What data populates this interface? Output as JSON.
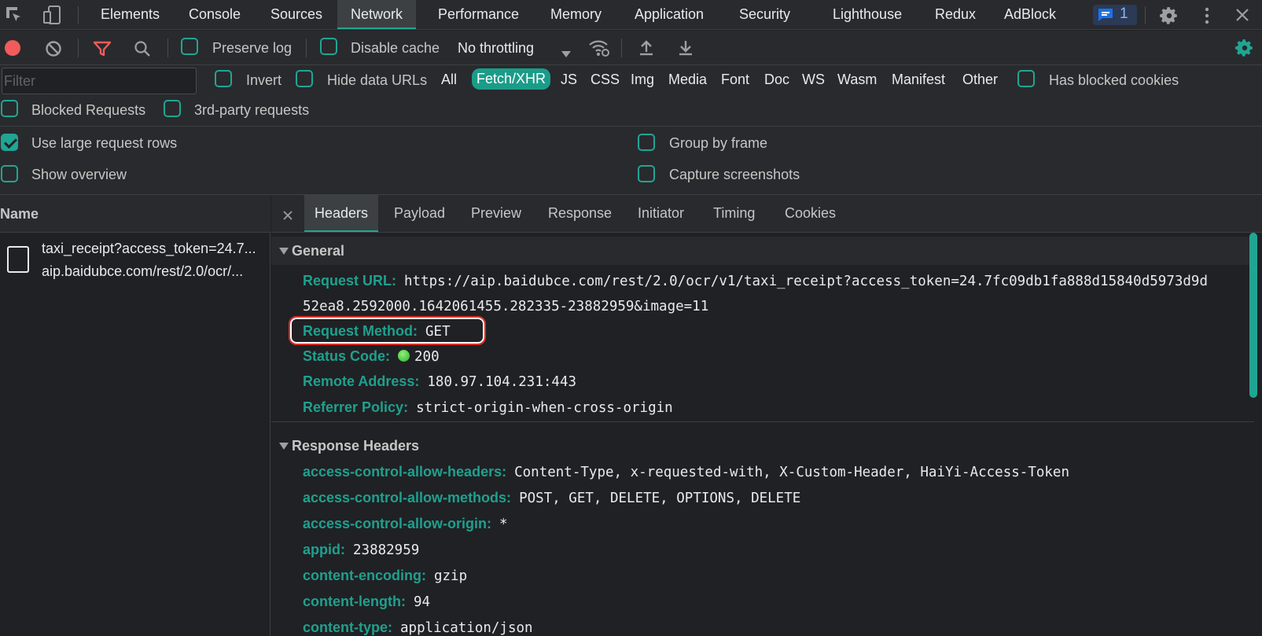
{
  "tabs": [
    "Elements",
    "Console",
    "Sources",
    "Network",
    "Performance",
    "Memory",
    "Application",
    "Security",
    "Lighthouse",
    "Redux",
    "AdBlock"
  ],
  "active_tab": "Network",
  "issues_badge": {
    "count": "1",
    "color": "#1a73e8"
  },
  "toolbar": {
    "preserve_log": "Preserve log",
    "disable_cache": "Disable cache",
    "throttling": "No throttling"
  },
  "filter": {
    "placeholder": "Filter",
    "invert": "Invert",
    "hide_data_urls": "Hide data URLs",
    "types": [
      "All",
      "Fetch/XHR",
      "JS",
      "CSS",
      "Img",
      "Media",
      "Font",
      "Doc",
      "WS",
      "Wasm",
      "Manifest",
      "Other"
    ],
    "active_type": "Fetch/XHR",
    "has_blocked_cookies": "Has blocked cookies",
    "blocked_requests": "Blocked Requests",
    "third_party": "3rd-party requests"
  },
  "settings": {
    "large_rows": "Use large request rows",
    "show_overview": "Show overview",
    "group_by_frame": "Group by frame",
    "capture_screenshots": "Capture screenshots"
  },
  "request_list": {
    "header": "Name",
    "items": [
      {
        "name": "taxi_receipt?access_token=24.7...",
        "path": "aip.baidubce.com/rest/2.0/ocr/..."
      }
    ]
  },
  "detail": {
    "tabs": [
      "Headers",
      "Payload",
      "Preview",
      "Response",
      "Initiator",
      "Timing",
      "Cookies"
    ],
    "active_tab": "Headers",
    "general": {
      "title": "General",
      "request_url_key": "Request URL:",
      "request_url_line1": "https://aip.baidubce.com/rest/2.0/ocr/v1/taxi_receipt?access_token=24.7fc09db1fa888d15840d5973d9d",
      "request_url_line2": "52ea8.2592000.1642061455.282335-23882959&image=11",
      "request_method_key": "Request Method:",
      "request_method": "GET",
      "status_code_key": "Status Code:",
      "status_code": "200",
      "remote_address_key": "Remote Address:",
      "remote_address": "180.97.104.231:443",
      "referrer_policy_key": "Referrer Policy:",
      "referrer_policy": "strict-origin-when-cross-origin"
    },
    "response_headers": {
      "title": "Response Headers",
      "rows": [
        {
          "key": "access-control-allow-headers:",
          "value": "Content-Type, x-requested-with, X-Custom-Header, HaiYi-Access-Token"
        },
        {
          "key": "access-control-allow-methods:",
          "value": "POST, GET, DELETE, OPTIONS, DELETE"
        },
        {
          "key": "access-control-allow-origin:",
          "value": "*"
        },
        {
          "key": "appid:",
          "value": "23882959"
        },
        {
          "key": "content-encoding:",
          "value": "gzip"
        },
        {
          "key": "content-length:",
          "value": "94"
        },
        {
          "key": "content-type:",
          "value": "application/json"
        }
      ]
    }
  },
  "colors": {
    "accent": "#20a593",
    "record": "#f15b5b",
    "status_ok": "#34c759",
    "highlight": "#d93025"
  }
}
